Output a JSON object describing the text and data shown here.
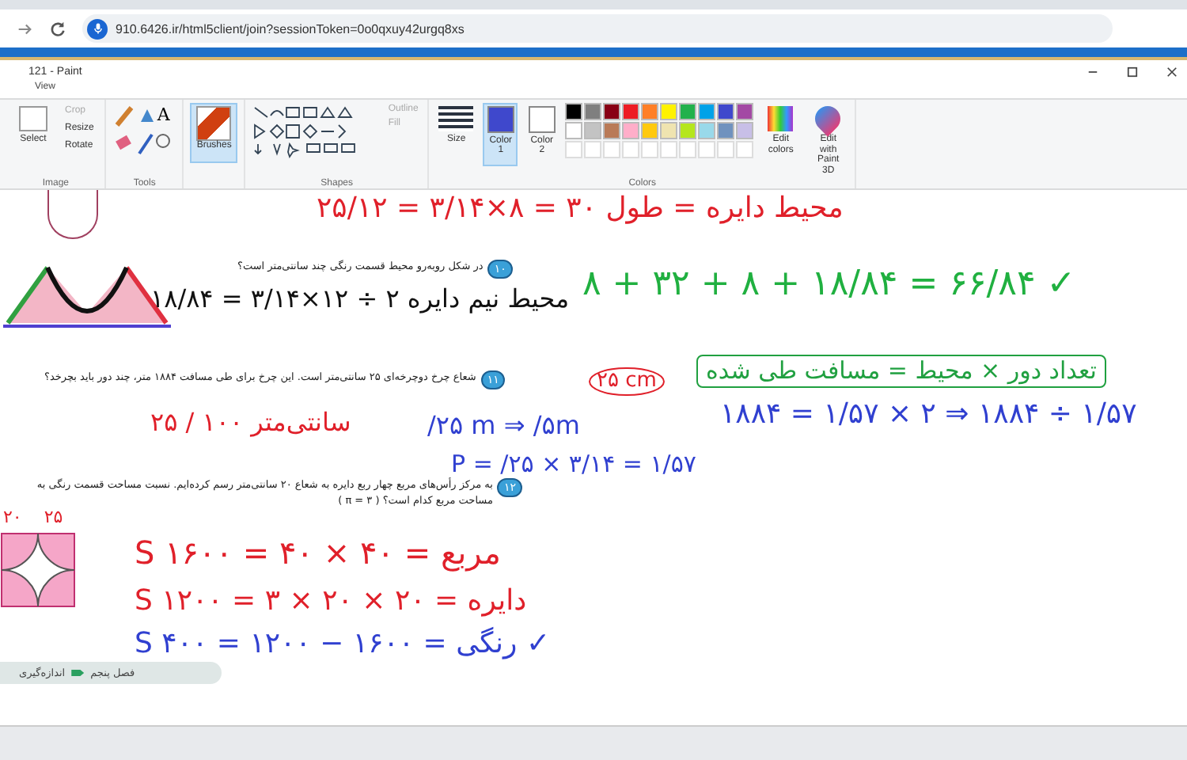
{
  "browser": {
    "url": "910.6426.ir/html5client/join?sessionToken=0o0qxuy42urgq8xs"
  },
  "window": {
    "title": "121 - Paint"
  },
  "menu_tabs": [
    {
      "label": "View",
      "selected": false
    }
  ],
  "ribbon": {
    "image": {
      "label": "Image",
      "select": "Select",
      "actions": [
        {
          "label": "Crop",
          "disabled": true
        },
        {
          "label": "Resize",
          "disabled": false
        },
        {
          "label": "Rotate",
          "disabled": false
        }
      ]
    },
    "tools": {
      "label": "Tools",
      "text_tool": "A"
    },
    "brushes": {
      "label": "Brushes",
      "selected": true
    },
    "shapes": {
      "label": "Shapes",
      "outline": "Outline",
      "fill": "Fill"
    },
    "size": {
      "label": "Size"
    },
    "color_1": {
      "label": "Color 1",
      "selected": true,
      "color": "#3f48cc"
    },
    "color_2": {
      "label": "Color 2",
      "selected": false,
      "color": "#ffffff"
    },
    "colors": {
      "label": "Colors",
      "palette": [
        {
          "color": "#000000"
        },
        {
          "color": "#7f7f7f"
        },
        {
          "color": "#880015"
        },
        {
          "color": "#ed1c24"
        },
        {
          "color": "#ff7f27"
        },
        {
          "color": "#fff200"
        },
        {
          "color": "#22b14c"
        },
        {
          "color": "#00a2e8"
        },
        {
          "color": "#3f48cc"
        },
        {
          "color": "#a349a4"
        },
        {
          "color": "#ffffff"
        },
        {
          "color": "#c3c3c3"
        },
        {
          "color": "#b97a57"
        },
        {
          "color": "#ffaec9"
        },
        {
          "color": "#ffc90e"
        },
        {
          "color": "#efe4b0"
        },
        {
          "color": "#b5e61d"
        },
        {
          "color": "#99d9ea"
        },
        {
          "color": "#7092be"
        },
        {
          "color": "#c8bfe7"
        }
      ]
    },
    "edit_colors": "Edit colors",
    "edit_paint3d": "Edit with Paint 3D"
  },
  "canvas": {
    "questions": [
      {
        "number": "۱۰",
        "text": "در شکل روبه‌رو محیط قسمت رنگی چند سانتی‌متر است؟"
      },
      {
        "number": "۱۱",
        "text": "شعاع چرخ دوچرخه‌ای ۲۵ سانتی‌متر است. این چرخ برای طی مسافت ۱۸۸۴ متر، چند دور باید بچرخد؟"
      },
      {
        "number": "۱۲",
        "text": "به مرکز رأس‌های مربع چهار ربع دایره به شعاع ۲۰ سانتی‌متر رسم کرده‌ایم. نسبت مساحت قسمت رنگی به مساحت مربع کدام است؟ ( π = ۳ )"
      }
    ],
    "ink": [
      {
        "text": "محیط دایره = طول ۳۰ = ۸×۳/۱۴ = ۲۵/۱۲",
        "color": "#e0202a"
      },
      {
        "text": "محیط نیم دایره ۲ ÷ ۱۲×۳/۱۴ = ۱۸/۸۴",
        "color": "#111111"
      },
      {
        "text": "۸ + ۳۲ + ۸ + ۱۸/۸۴ = ۶۶/۸۴ ✓",
        "color": "#20b040"
      },
      {
        "text": "۲۵ cm",
        "color": "#e0202a"
      },
      {
        "text": "تعداد دور × محیط = مسافت طی شده",
        "color": "#20a040"
      },
      {
        "text": "۱۸۸۴ = ۱/۵۷ × ۲ ⇒ ۱۸۸۴ ÷ ۱/۵۷",
        "color": "#3040d0"
      },
      {
        "text": "/۲۵ m ⇒ /۵m",
        "color": "#3040d0"
      },
      {
        "text": "۲۵ / ۱۰۰ سانتی‌متر",
        "color": "#e0202a"
      },
      {
        "text": "P = /۲۵ × ۳/۱۴ = ۱/۵۷",
        "color": "#3040d0"
      },
      {
        "text": "S مربع = ۴۰ × ۴۰ = ۱۶۰۰",
        "color": "#e0202a"
      },
      {
        "text": "S دایره = ۲۰ × ۲۰ × ۳ = ۱۲۰۰",
        "color": "#e0202a"
      },
      {
        "text": "S رنگی = ۱۶۰۰ − ۱۲۰۰ = ۴۰۰ ✓",
        "color": "#3040d0"
      }
    ],
    "square_labels": [
      "۲۵",
      "۲۰"
    ],
    "footer": {
      "chapter": "اندازه‌گیری",
      "section": "فصل پنجم"
    }
  }
}
